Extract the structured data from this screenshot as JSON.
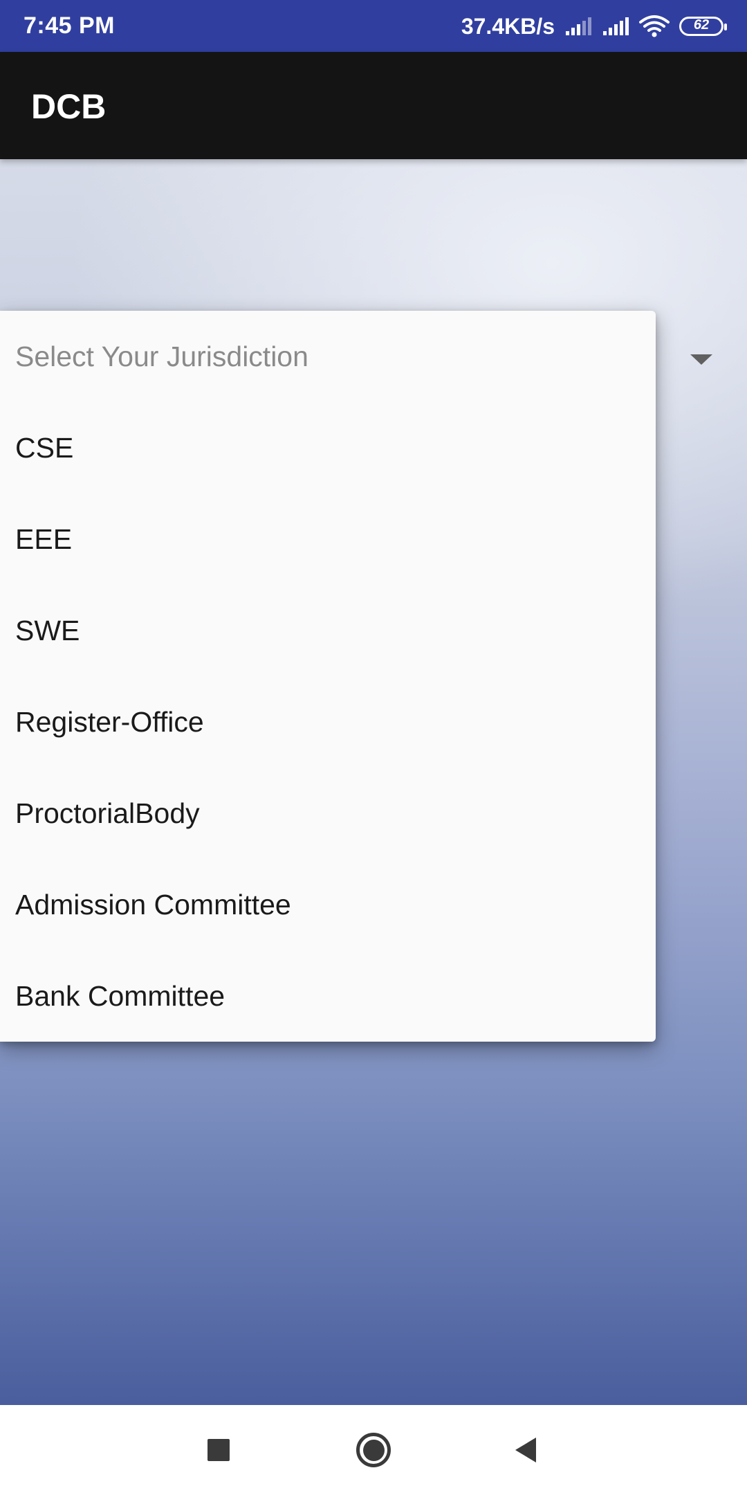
{
  "status_bar": {
    "time": "7:45 PM",
    "net_speed": "37.4KB/s",
    "battery_level": "62",
    "icons": [
      "signal-icon",
      "signal-icon",
      "wifi-icon",
      "battery-icon"
    ]
  },
  "app_bar": {
    "title": "DCB"
  },
  "spinner": {
    "arrow_icon": "dropdown-arrow-icon"
  },
  "dropdown": {
    "placeholder": "Select Your Jurisdiction",
    "options": [
      "CSE",
      "EEE",
      "SWE",
      "Register-Office",
      "ProctorialBody",
      "Admission Committee",
      "Bank Committee"
    ]
  },
  "nav_bar": {
    "buttons": [
      "recents-icon",
      "home-icon",
      "back-icon"
    ]
  },
  "colors": {
    "status_bar": "#303f9f",
    "app_bar": "#141414",
    "dropdown_bg": "#fafafa"
  }
}
